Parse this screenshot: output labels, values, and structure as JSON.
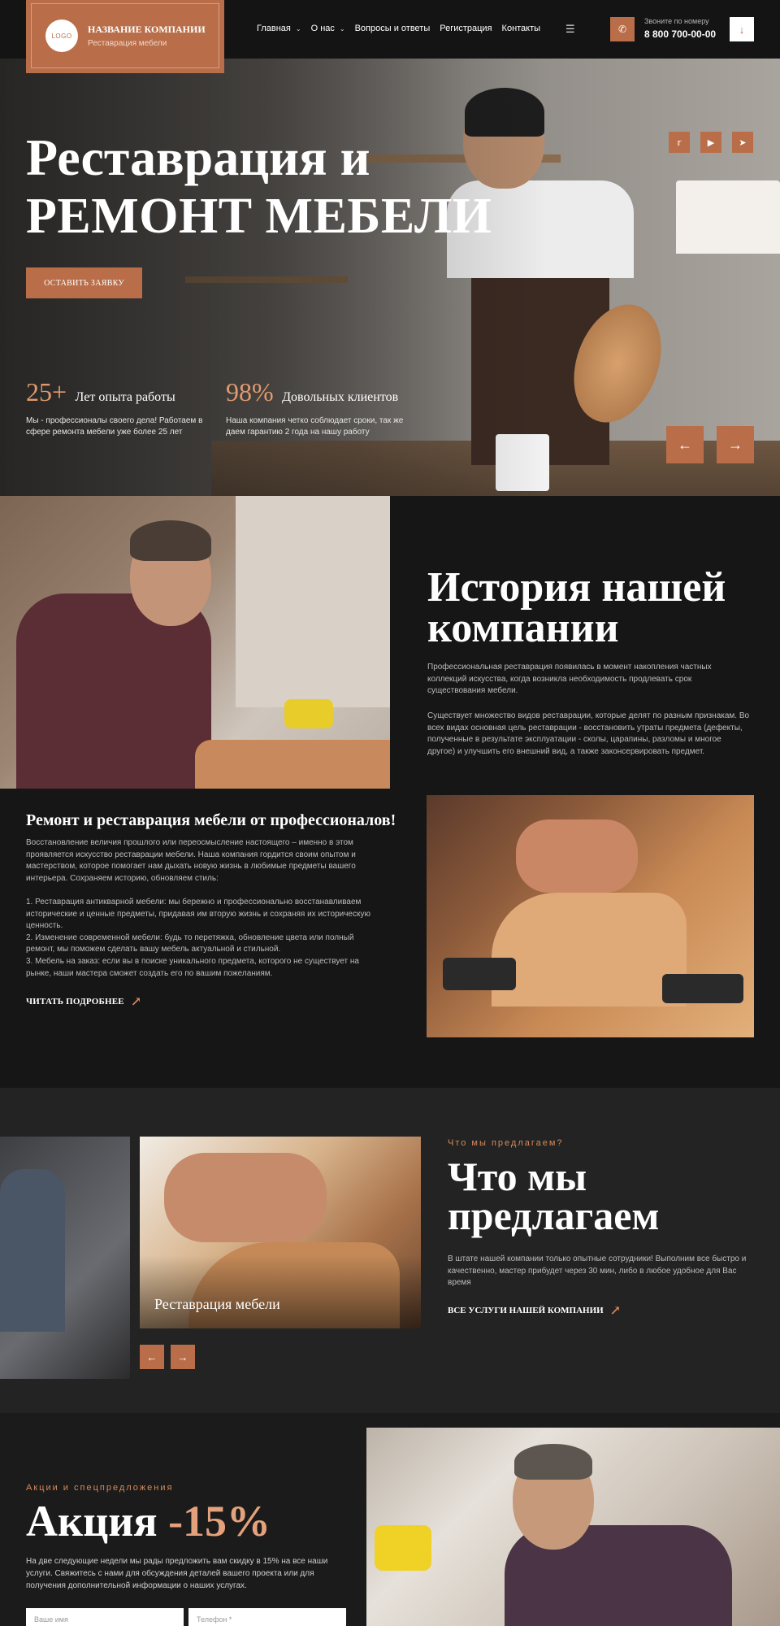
{
  "header": {
    "logo_text": "LOGO",
    "company_name": "НАЗВАНИЕ КОМПАНИИ",
    "company_sub": "Реставрация мебели",
    "nav": [
      {
        "label": "Главная",
        "dropdown": true
      },
      {
        "label": "О нас",
        "dropdown": true
      },
      {
        "label": "Вопросы и ответы",
        "dropdown": false
      },
      {
        "label": "Регистрация",
        "dropdown": false
      },
      {
        "label": "Контакты",
        "dropdown": false
      }
    ],
    "phone_label": "Звоните по номеру",
    "phone_number": "8 800 700-00-00"
  },
  "hero": {
    "title_line1": "Реставрация и",
    "title_line2": "РЕМОНТ МЕБЕЛИ",
    "cta": "ОСТАВИТЬ ЗАЯВКУ",
    "stats": [
      {
        "num": "25+",
        "label": "Лет опыта работы",
        "desc": "Мы - профессионалы своего дела! Работаем в сфере ремонта мебели уже более 25 лет"
      },
      {
        "num": "98%",
        "label": "Довольных клиентов",
        "desc": "Наша компания четко соблюдает сроки, так же даем гарантию 2 года на нашу работу"
      }
    ],
    "social": [
      "twitter-icon",
      "youtube-icon",
      "telegram-icon"
    ]
  },
  "history": {
    "title_line1": "История нашей",
    "title_line2": "компании",
    "p1": "Профессиональная реставрация появилась в момент накопления частных коллекций искусства, когда возникла необходимость продлевать срок существования мебели.",
    "p2": "Существует множество видов реставрации, которые делят по разным признакам. Во всех видах основная цель реставрации - восстановить утраты предмета (дефекты, полученные в результате эксплуатации - сколы, царапины, разломы и многое другое) и улучшить его внешний вид, а также законсервировать предмет.",
    "subtitle": "Ремонт и реставрация мебели от профессионалов!",
    "body": "Восстановление величия прошлого или переосмысление настоящего – именно в этом проявляется искусство реставрации мебели. Наша компания гордится своим опытом и мастерством, которое помогает нам дыхать новую жизнь в любимые предметы вашего интерьера. Сохраняем историю, обновляем стиль:\n\n1. Реставрация антикварной мебели: мы бережно и профессионально восстанавливаем исторические и ценные предметы, придавая им вторую жизнь и сохраняя их историческую ценность.\n2. Изменение современной мебели: будь то перетяжка, обновление цвета или полный ремонт, мы поможем сделать вашу мебель актуальной и стильной.\n3. Мебель на заказ: если вы в поиске уникального предмета, которого не существует на рынке, наши мастера сможет создать его по вашим пожеланиям.",
    "read_more": "ЧИТАТЬ ПОДРОБНЕЕ"
  },
  "services": {
    "card_label": "Реставрация мебели",
    "eyebrow": "Что мы предлагаем?",
    "title_line1": "Что мы",
    "title_line2": "предлагаем",
    "desc": "В штате нашей компании только опытные сотрудники! Выполним все быстро и качественно, мастер прибудет через 30 мин, либо в любое удобное для Вас время",
    "link": "ВСЕ УСЛУГИ НАШЕЙ КОМПАНИИ"
  },
  "promo": {
    "eyebrow": "Акции и спецпредложения",
    "title_word": "Акция",
    "title_pct": "-15%",
    "desc": "На две следующие недели мы рады предложить вам скидку в 15% на все наши услуги. Свяжитесь с нами для обсуждения деталей вашего проекта или для получения дополнительной информации о наших услугах.",
    "name_placeholder": "Ваше имя",
    "phone_placeholder": "Телефон *"
  },
  "colors": {
    "accent": "#b96e49",
    "accent_light": "#e09a6e",
    "bg_dark": "#161616"
  }
}
